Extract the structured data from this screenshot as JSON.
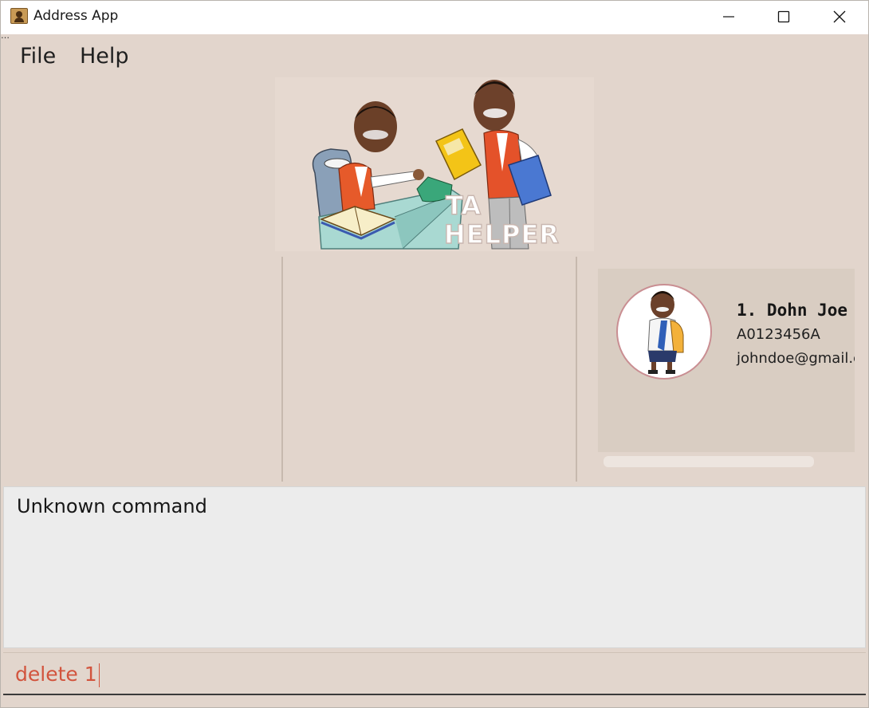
{
  "window": {
    "title": "Address App"
  },
  "menu": {
    "items": [
      {
        "label": "File"
      },
      {
        "label": "Help"
      }
    ]
  },
  "banner": {
    "lines": [
      "TA",
      "HELPER"
    ]
  },
  "person_list": [
    {
      "index": "1.",
      "name": "Dohn Joe",
      "name_line": "1.  Dohn Joe",
      "student_id": "A0123456A",
      "email": "johndoe@gmail.com"
    }
  ],
  "result": {
    "message": "Unknown command"
  },
  "command": {
    "value": "delete 1"
  },
  "colors": {
    "background": "#e2d5cc",
    "card": "#d9cdc2",
    "result_bg": "#ececec",
    "command_text": "#d2543d"
  }
}
